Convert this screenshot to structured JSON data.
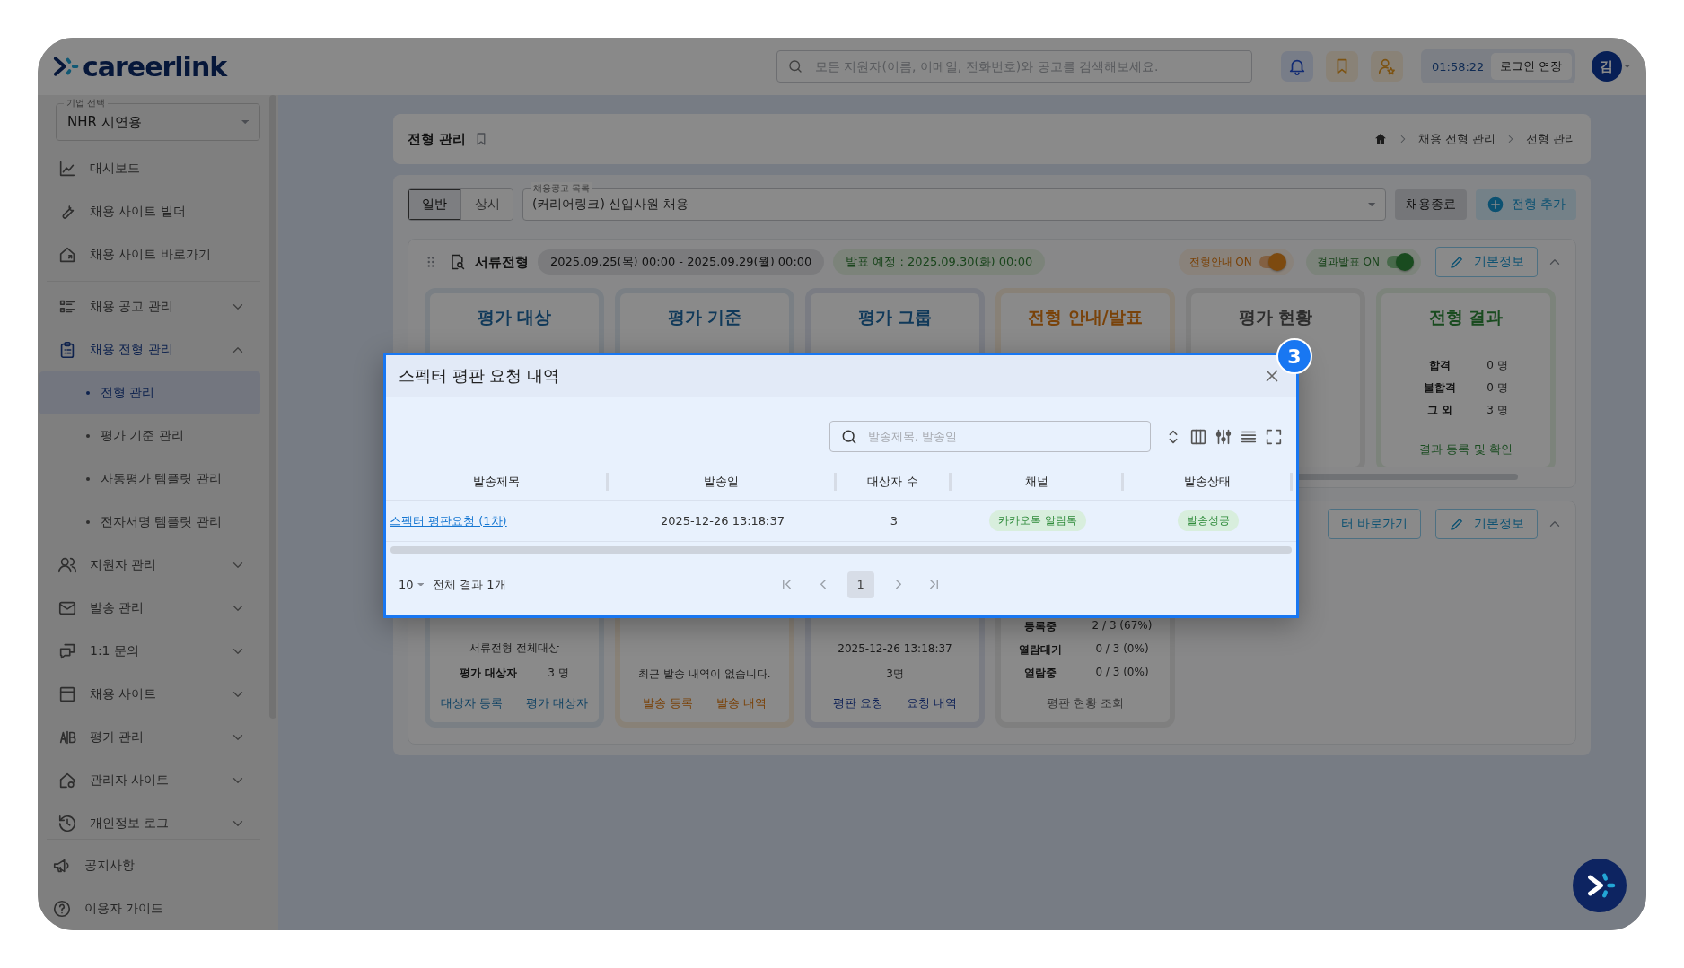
{
  "header": {
    "logo": "careerlink",
    "search": {
      "placeholder": "모든 지원자(이름, 이메일, 전화번호)와 공고를 검색해보세요."
    },
    "timer": "01:58:22",
    "extend_button": "로그인 연장",
    "avatar": "김"
  },
  "sidebar": {
    "company_select": {
      "label": "기업 선택",
      "value": "NHR 시연용"
    },
    "items": [
      {
        "kind": "link",
        "label": "대시보드",
        "selected": false
      },
      {
        "kind": "link",
        "label": "채용 사이트 빌더",
        "selected": false
      },
      {
        "kind": "link",
        "label": "채용 사이트 바로가기",
        "selected": false
      },
      {
        "kind": "divider"
      },
      {
        "kind": "group",
        "label": "채용 공고 관리",
        "expanded": false
      },
      {
        "kind": "group",
        "label": "채용 전형 관리",
        "expanded": true,
        "children": [
          {
            "label": "전형 관리",
            "selected": true
          },
          {
            "label": "평가 기준 관리",
            "selected": false
          },
          {
            "label": "자동평가 템플릿 관리",
            "selected": false
          },
          {
            "label": "전자서명 템플릿 관리",
            "selected": false
          }
        ]
      },
      {
        "kind": "group",
        "label": "지원자 관리",
        "expanded": false
      },
      {
        "kind": "group",
        "label": "발송 관리",
        "expanded": false
      },
      {
        "kind": "group",
        "label": "1:1 문의",
        "expanded": false
      },
      {
        "kind": "group",
        "label": "채용 사이트",
        "expanded": false
      },
      {
        "kind": "group",
        "label": "평가 관리",
        "expanded": false
      },
      {
        "kind": "group",
        "label": "관리자 사이트",
        "expanded": false
      },
      {
        "kind": "group",
        "label": "개인정보 로그",
        "expanded": false
      }
    ],
    "footer": [
      "공지사항",
      "이용자 가이드"
    ]
  },
  "page_header": {
    "title": "전형 관리",
    "breadcrumb": [
      "채용 전형 관리",
      "전형 관리"
    ]
  },
  "toolbar": {
    "modes": [
      {
        "label": "일반",
        "selected": true
      },
      {
        "label": "상시",
        "selected": false
      }
    ],
    "posting_select": {
      "label": "채용공고 목록",
      "value": "(커리어링크) 신입사원 채용"
    },
    "end_button": "채용종료",
    "add_button": "전형 추가"
  },
  "stages": [
    {
      "name": "서류전형",
      "period": "2025.09.25(목) 00:00 - 2025.09.29(월) 00:00",
      "announce": "발표 예정 : 2025.09.30(화) 00:00",
      "toggles": [
        {
          "kind": "guide",
          "label": "전형안내 ON",
          "on": true
        },
        {
          "kind": "result",
          "label": "결과발표 ON",
          "on": true
        }
      ],
      "info_button": "기본정보",
      "expanded": true,
      "cards": [
        {
          "kind": "target",
          "title": "평가 대상"
        },
        {
          "kind": "criteria",
          "title": "평가 기준"
        },
        {
          "kind": "group",
          "title": "평가 그룹"
        },
        {
          "kind": "notice",
          "title": "전형 안내/발표"
        },
        {
          "kind": "status",
          "title": "평가 현황"
        },
        {
          "kind": "result",
          "title": "전형 결과",
          "stats": [
            {
              "label": "합격",
              "value": "0 명"
            },
            {
              "label": "불합격",
              "value": "0 명"
            },
            {
              "label": "그 외",
              "value": "3 명"
            }
          ],
          "links": [
            "결과 등록 및 확인"
          ]
        }
      ]
    },
    {
      "shortcut_button": "터 바로가기",
      "info_button": "기본정보",
      "expanded": true,
      "cards": [
        {
          "kind": "target",
          "lines": [
            "서류전형 전체대상"
          ],
          "stats": [
            {
              "label": "평가 대상자",
              "value": "3 명"
            }
          ],
          "links": [
            "대상자 등록",
            "평가 대상자"
          ]
        },
        {
          "kind": "notice",
          "lines": [
            "최근 발송 내역이 없습니다."
          ],
          "links": [
            "발송 등록",
            "발송 내역"
          ]
        },
        {
          "kind": "group",
          "lines": [
            "2025-12-26 13:18:37",
            "3명"
          ],
          "links": [
            "평판 요청",
            "요청 내역"
          ]
        },
        {
          "kind": "status",
          "stats": [
            {
              "label": "등록중",
              "value": "2 / 3 (67%)"
            },
            {
              "label": "열람대기",
              "value": "0 / 3 (0%)"
            },
            {
              "label": "열람중",
              "value": "0 / 3 (0%)"
            }
          ],
          "links": [
            "평판 현황 조회"
          ]
        }
      ]
    }
  ],
  "modal": {
    "title": "스펙터 평판 요청 내역",
    "step_badge": "3",
    "search": {
      "placeholder": "발송제목, 발송일"
    },
    "table": {
      "columns": [
        "발송제목",
        "발송일",
        "대상자 수",
        "채널",
        "발송상태"
      ],
      "rows": [
        [
          "스펙터 평판요청 (1차)",
          "2025-12-26 13:18:37",
          "3",
          "카카오톡 알림톡",
          "발송성공"
        ]
      ]
    },
    "footer": {
      "page_size": "10",
      "total": "전체 결과 1개",
      "pages": [
        {
          "label": "1",
          "selected": true
        }
      ]
    }
  }
}
